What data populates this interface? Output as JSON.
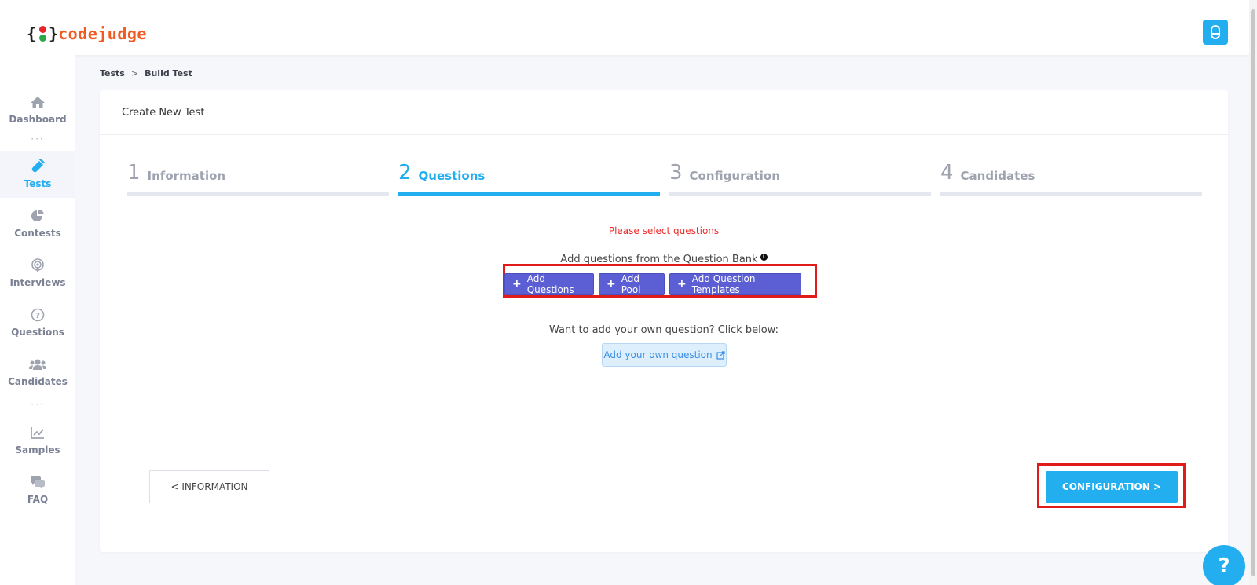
{
  "app": {
    "logo_prefix": "{",
    "logo_suffix": "}",
    "logo_word": "codejudge",
    "accent": "#23aef0",
    "brand_orange": "#f15a22"
  },
  "header": {
    "profile_icon": "user-icon"
  },
  "sidebar": {
    "items": [
      {
        "label": "Dashboard",
        "icon": "home-icon",
        "active": false
      },
      {
        "label": "Tests",
        "icon": "test-tube-icon",
        "active": true
      },
      {
        "label": "Contests",
        "icon": "pie-chart-icon",
        "active": false
      },
      {
        "label": "Interviews",
        "icon": "podcast-icon",
        "active": false
      },
      {
        "label": "Questions",
        "icon": "question-circle-icon",
        "active": false
      },
      {
        "label": "Candidates",
        "icon": "users-icon",
        "active": false
      },
      {
        "label": "Samples",
        "icon": "line-chart-icon",
        "active": false
      },
      {
        "label": "FAQ",
        "icon": "comments-icon",
        "active": false
      }
    ],
    "separator": "···"
  },
  "breadcrumb": {
    "items": [
      "Tests",
      "Build Test"
    ],
    "separator": ">"
  },
  "card": {
    "title": "Create New Test",
    "steps": [
      {
        "num": "1",
        "label": "Information"
      },
      {
        "num": "2",
        "label": "Questions"
      },
      {
        "num": "3",
        "label": "Configuration"
      },
      {
        "num": "4",
        "label": "Candidates"
      }
    ],
    "active_step": 2,
    "warning": "Please select questions",
    "bank_label": "Add questions from the Question Bank",
    "info_glyph": "i",
    "buttons": {
      "plus": "+",
      "add_questions": "Add Questions",
      "add_pool": "Add Pool",
      "add_templates": "Add Question Templates"
    },
    "own_label": "Want to add your own question? Click below:",
    "own_button": "Add your own question",
    "prev_button": "< INFORMATION",
    "next_button": "CONFIGURATION >"
  },
  "help": {
    "label": "?"
  }
}
